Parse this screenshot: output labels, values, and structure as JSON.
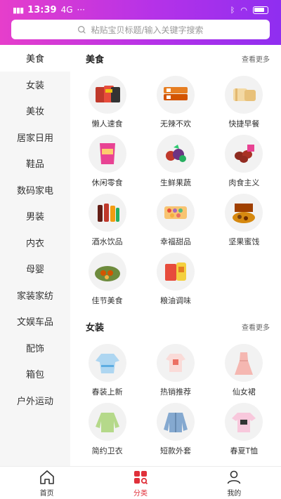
{
  "status": {
    "time": "13:39",
    "network": "4G",
    "battery_label": ""
  },
  "search": {
    "placeholder": "粘贴宝贝标题/输入关键字搜索"
  },
  "sidebar": {
    "items": [
      {
        "label": "美食",
        "active": true
      },
      {
        "label": "女装"
      },
      {
        "label": "美妆"
      },
      {
        "label": "居家日用"
      },
      {
        "label": "鞋品"
      },
      {
        "label": "数码家电"
      },
      {
        "label": "男装"
      },
      {
        "label": "内衣"
      },
      {
        "label": "母婴"
      },
      {
        "label": "家装家纺"
      },
      {
        "label": "文娱车品"
      },
      {
        "label": "配饰"
      },
      {
        "label": "箱包"
      },
      {
        "label": "户外运动"
      }
    ]
  },
  "sections": [
    {
      "title": "美食",
      "more": "查看更多",
      "items": [
        {
          "label": "懒人速食",
          "icon": "instant-noodle-icon"
        },
        {
          "label": "无辣不欢",
          "icon": "spicy-snack-icon"
        },
        {
          "label": "快捷早餐",
          "icon": "bread-icon"
        },
        {
          "label": "休闲零食",
          "icon": "chips-icon"
        },
        {
          "label": "生鲜果蔬",
          "icon": "fruit-icon"
        },
        {
          "label": "肉食主义",
          "icon": "meat-icon"
        },
        {
          "label": "酒水饮品",
          "icon": "drinks-icon"
        },
        {
          "label": "幸福甜品",
          "icon": "dessert-icon"
        },
        {
          "label": "坚果蜜饯",
          "icon": "nuts-icon"
        },
        {
          "label": "佳节美食",
          "icon": "festival-food-icon"
        },
        {
          "label": "粮油调味",
          "icon": "oil-icon"
        }
      ]
    },
    {
      "title": "女装",
      "more": "查看更多",
      "items": [
        {
          "label": "春装上新",
          "icon": "blouse-icon"
        },
        {
          "label": "热销推荐",
          "icon": "top-icon"
        },
        {
          "label": "仙女裙",
          "icon": "dress-icon"
        },
        {
          "label": "简约卫衣",
          "icon": "sweatshirt-icon"
        },
        {
          "label": "短款外套",
          "icon": "jacket-icon"
        },
        {
          "label": "春夏T恤",
          "icon": "tshirt-icon"
        }
      ]
    }
  ],
  "tabs": [
    {
      "label": "首页",
      "icon": "home-icon"
    },
    {
      "label": "分类",
      "icon": "category-icon",
      "active": true
    },
    {
      "label": "我的",
      "icon": "profile-icon"
    }
  ],
  "colors": {
    "accent": "#e0303a",
    "header_start": "#e63ecb",
    "header_end": "#8f2ef0"
  }
}
